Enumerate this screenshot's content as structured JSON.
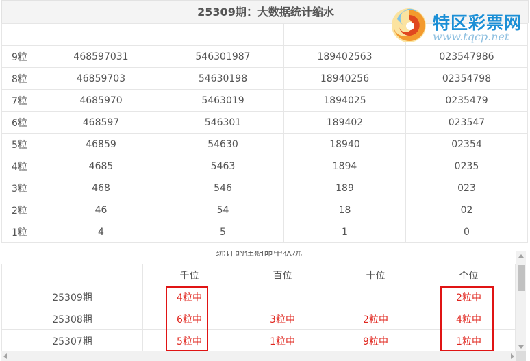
{
  "header": {
    "title": "25309期：大数据统计缩水"
  },
  "logo": {
    "name": "特区彩票网",
    "url": "www.tqcp.net"
  },
  "grid": {
    "rows": [
      {
        "label": "9粒",
        "cells": [
          "468597031",
          "546301987",
          "189402563",
          "023547986"
        ]
      },
      {
        "label": "8粒",
        "cells": [
          "46859703",
          "54630198",
          "18940256",
          "02354798"
        ]
      },
      {
        "label": "7粒",
        "cells": [
          "4685970",
          "5463019",
          "1894025",
          "0235479"
        ]
      },
      {
        "label": "6粒",
        "cells": [
          "468597",
          "546301",
          "189402",
          "023547"
        ]
      },
      {
        "label": "5粒",
        "cells": [
          "46859",
          "54630",
          "18940",
          "02354"
        ]
      },
      {
        "label": "4粒",
        "cells": [
          "4685",
          "5463",
          "1894",
          "0235"
        ]
      },
      {
        "label": "3粒",
        "cells": [
          "468",
          "546",
          "189",
          "023"
        ]
      },
      {
        "label": "2粒",
        "cells": [
          "46",
          "54",
          "18",
          "02"
        ]
      },
      {
        "label": "1粒",
        "cells": [
          "4",
          "5",
          "1",
          "0"
        ]
      }
    ]
  },
  "history": {
    "section_title": "统计的往期命中状况",
    "headers": [
      "",
      "千位",
      "百位",
      "十位",
      "个位"
    ],
    "rows": [
      {
        "period": "25309期",
        "cells": [
          "4粒中",
          "",
          "",
          "2粒中"
        ]
      },
      {
        "period": "25308期",
        "cells": [
          "6粒中",
          "3粒中",
          "2粒中",
          "4粒中"
        ]
      },
      {
        "period": "25307期",
        "cells": [
          "5粒中",
          "1粒中",
          "9粒中",
          "1粒中"
        ]
      }
    ]
  },
  "colors": {
    "hit": "#e0261e",
    "highlight_box": "#e01414",
    "brand": "#1b8fd6"
  }
}
